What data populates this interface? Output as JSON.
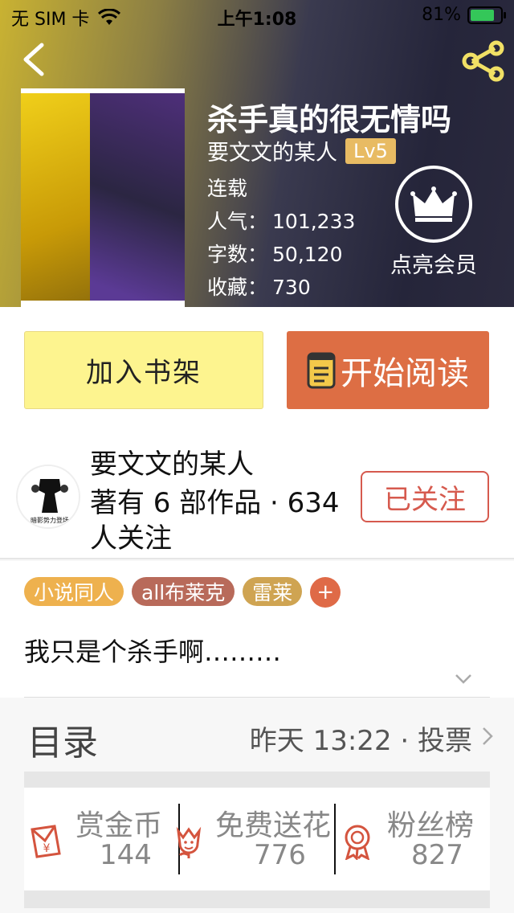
{
  "status_bar": {
    "carrier": "无 SIM 卡",
    "time": "上午1:08",
    "battery_percent": "81%",
    "battery_level": 0.81
  },
  "book": {
    "title": "杀手真的很无情吗",
    "author": "要文文的某人",
    "level": "Lv5",
    "status": "连载",
    "popularity_label": "人气：",
    "popularity": "101,233",
    "words_label": "字数：",
    "words": "50,120",
    "favorites_label": "收藏：",
    "favorites": "730",
    "vip_label": "点亮会员"
  },
  "actions": {
    "add_to_shelf": "加入书架",
    "start_reading": "开始阅读"
  },
  "author_card": {
    "name": "要文文的某人",
    "stats": "著有 6 部作品 · 634 人关注",
    "follow_label": "已关注",
    "avatar_caption": "暗影势力登场"
  },
  "tags": [
    {
      "label": "小说同人",
      "color": "#eeb14e"
    },
    {
      "label": "all布莱克",
      "color": "#b86a5a"
    },
    {
      "label": "雷莱",
      "color": "#cfa452"
    }
  ],
  "tag_add": "+",
  "synopsis": "我只是个杀手啊………",
  "catalogue": {
    "label": "目录",
    "right_text": "昨天 13:22 · 投票"
  },
  "bottom_stats": [
    {
      "title": "赏金币",
      "value": "144",
      "icon": "red-envelope-icon"
    },
    {
      "title": "免费送花",
      "value": "776",
      "icon": "flower-icon"
    },
    {
      "title": "粉丝榜",
      "value": "827",
      "icon": "medal-icon"
    }
  ]
}
